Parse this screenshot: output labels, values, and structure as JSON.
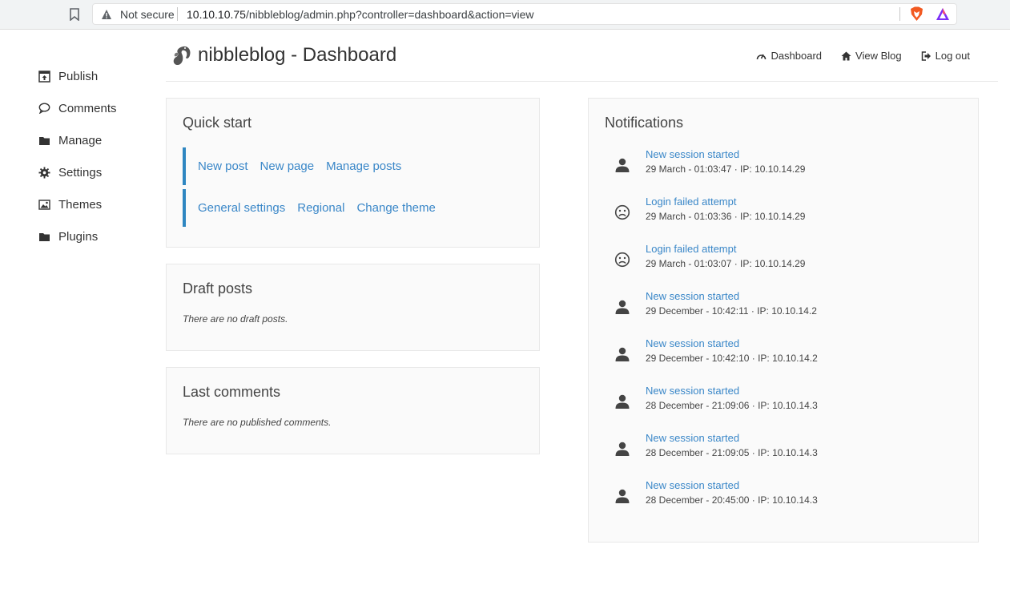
{
  "browser": {
    "security_label": "Not secure",
    "url_host": "10.10.10.75",
    "url_path": "/nibbleblog/admin.php?controller=dashboard&action=view"
  },
  "sidebar": {
    "items": [
      {
        "label": "Publish",
        "icon": "publish-icon"
      },
      {
        "label": "Comments",
        "icon": "comment-icon"
      },
      {
        "label": "Manage",
        "icon": "folder-icon"
      },
      {
        "label": "Settings",
        "icon": "gear-icon"
      },
      {
        "label": "Themes",
        "icon": "image-icon"
      },
      {
        "label": "Plugins",
        "icon": "folder-icon"
      }
    ]
  },
  "header": {
    "title": "nibbleblog - Dashboard",
    "nav": [
      {
        "label": "Dashboard",
        "icon": "gauge-icon"
      },
      {
        "label": "View Blog",
        "icon": "home-icon"
      },
      {
        "label": "Log out",
        "icon": "logout-icon"
      }
    ]
  },
  "quick_start": {
    "title": "Quick start",
    "row1": [
      "New post",
      "New page",
      "Manage posts"
    ],
    "row2": [
      "General settings",
      "Regional",
      "Change theme"
    ]
  },
  "draft_posts": {
    "title": "Draft posts",
    "empty": "There are no draft posts."
  },
  "last_comments": {
    "title": "Last comments",
    "empty": "There are no published comments."
  },
  "notifications": {
    "title": "Notifications",
    "items": [
      {
        "icon": "user-icon",
        "title": "New session started",
        "detail": "29 March - 01:03:47 · IP: 10.10.14.29"
      },
      {
        "icon": "sad-face-icon",
        "title": "Login failed attempt",
        "detail": "29 March - 01:03:36 · IP: 10.10.14.29"
      },
      {
        "icon": "sad-face-icon",
        "title": "Login failed attempt",
        "detail": "29 March - 01:03:07 · IP: 10.10.14.29"
      },
      {
        "icon": "user-icon",
        "title": "New session started",
        "detail": "29 December - 10:42:11 · IP: 10.10.14.2"
      },
      {
        "icon": "user-icon",
        "title": "New session started",
        "detail": "29 December - 10:42:10 · IP: 10.10.14.2"
      },
      {
        "icon": "user-icon",
        "title": "New session started",
        "detail": "28 December - 21:09:06 · IP: 10.10.14.3"
      },
      {
        "icon": "user-icon",
        "title": "New session started",
        "detail": "28 December - 21:09:05 · IP: 10.10.14.3"
      },
      {
        "icon": "user-icon",
        "title": "New session started",
        "detail": "28 December - 20:45:00 · IP: 10.10.14.3"
      }
    ]
  },
  "colors": {
    "link": "#3a87c8",
    "accent_bar": "#2e86c1"
  }
}
